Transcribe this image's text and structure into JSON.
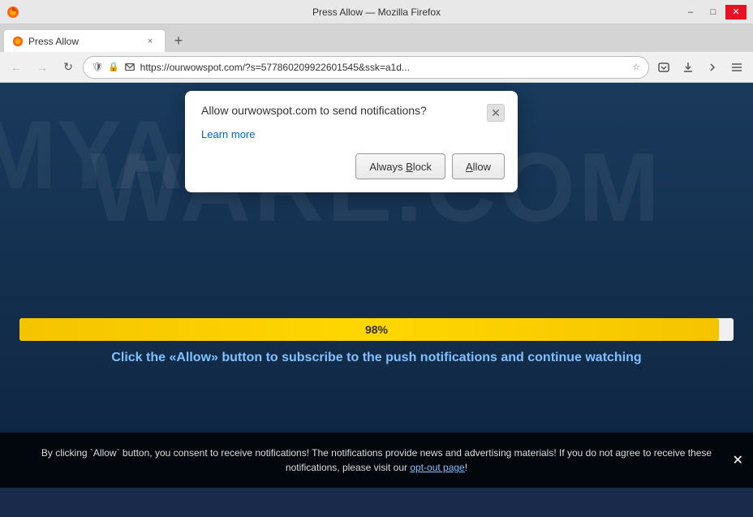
{
  "titlebar": {
    "title": "Press Allow — Mozilla Firefox",
    "min_label": "–",
    "max_label": "□",
    "close_label": "✕"
  },
  "tab": {
    "title": "Press Allow",
    "close_label": "×"
  },
  "new_tab_btn": "+",
  "navbar": {
    "back_icon": "←",
    "forward_icon": "→",
    "reload_icon": "↻",
    "url": "https://ourwowspot.com/?s=577860209922601545&ssk=a1d...",
    "bookmark_icon": "☆"
  },
  "popup": {
    "title": "Allow ourwowspot.com to send notifications?",
    "learn_more": "Learn more",
    "always_block_label": "Always Block",
    "allow_label": "Allow",
    "close_label": "✕"
  },
  "page": {
    "watermark_top": "WARE.COM",
    "watermark_side": "MYANTI",
    "progress_value": 98,
    "progress_label": "98%",
    "subscribe_text_prefix": "Click the ",
    "subscribe_allow": "«Allow»",
    "subscribe_text_suffix": " button to subscribe to the push notifications and continue watching"
  },
  "bottom_banner": {
    "text": "By clicking `Allow` button, you consent to receive notifications! The notifications provide news and advertising materials! If you do not agree to receive these notifications, please visit our ",
    "link_text": "opt-out page",
    "text_suffix": "!",
    "close_label": "✕"
  }
}
